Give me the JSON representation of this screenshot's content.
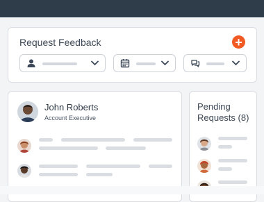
{
  "request_feedback": {
    "title": "Request Feedback",
    "add_icon": "plus-circle-icon",
    "filters": [
      {
        "icon": "person-icon",
        "value": ""
      },
      {
        "icon": "calendar-icon",
        "value": ""
      },
      {
        "icon": "chat-icon",
        "value": ""
      }
    ]
  },
  "person": {
    "name": "John Roberts",
    "role": "Account Executive"
  },
  "pending": {
    "title_line1": "Pending",
    "title_line2": "Requests (8)"
  },
  "colors": {
    "topbar": "#2f3d4a",
    "accent": "#f15a22",
    "placeholder": "#dadde2",
    "background": "#f3f4f6"
  }
}
